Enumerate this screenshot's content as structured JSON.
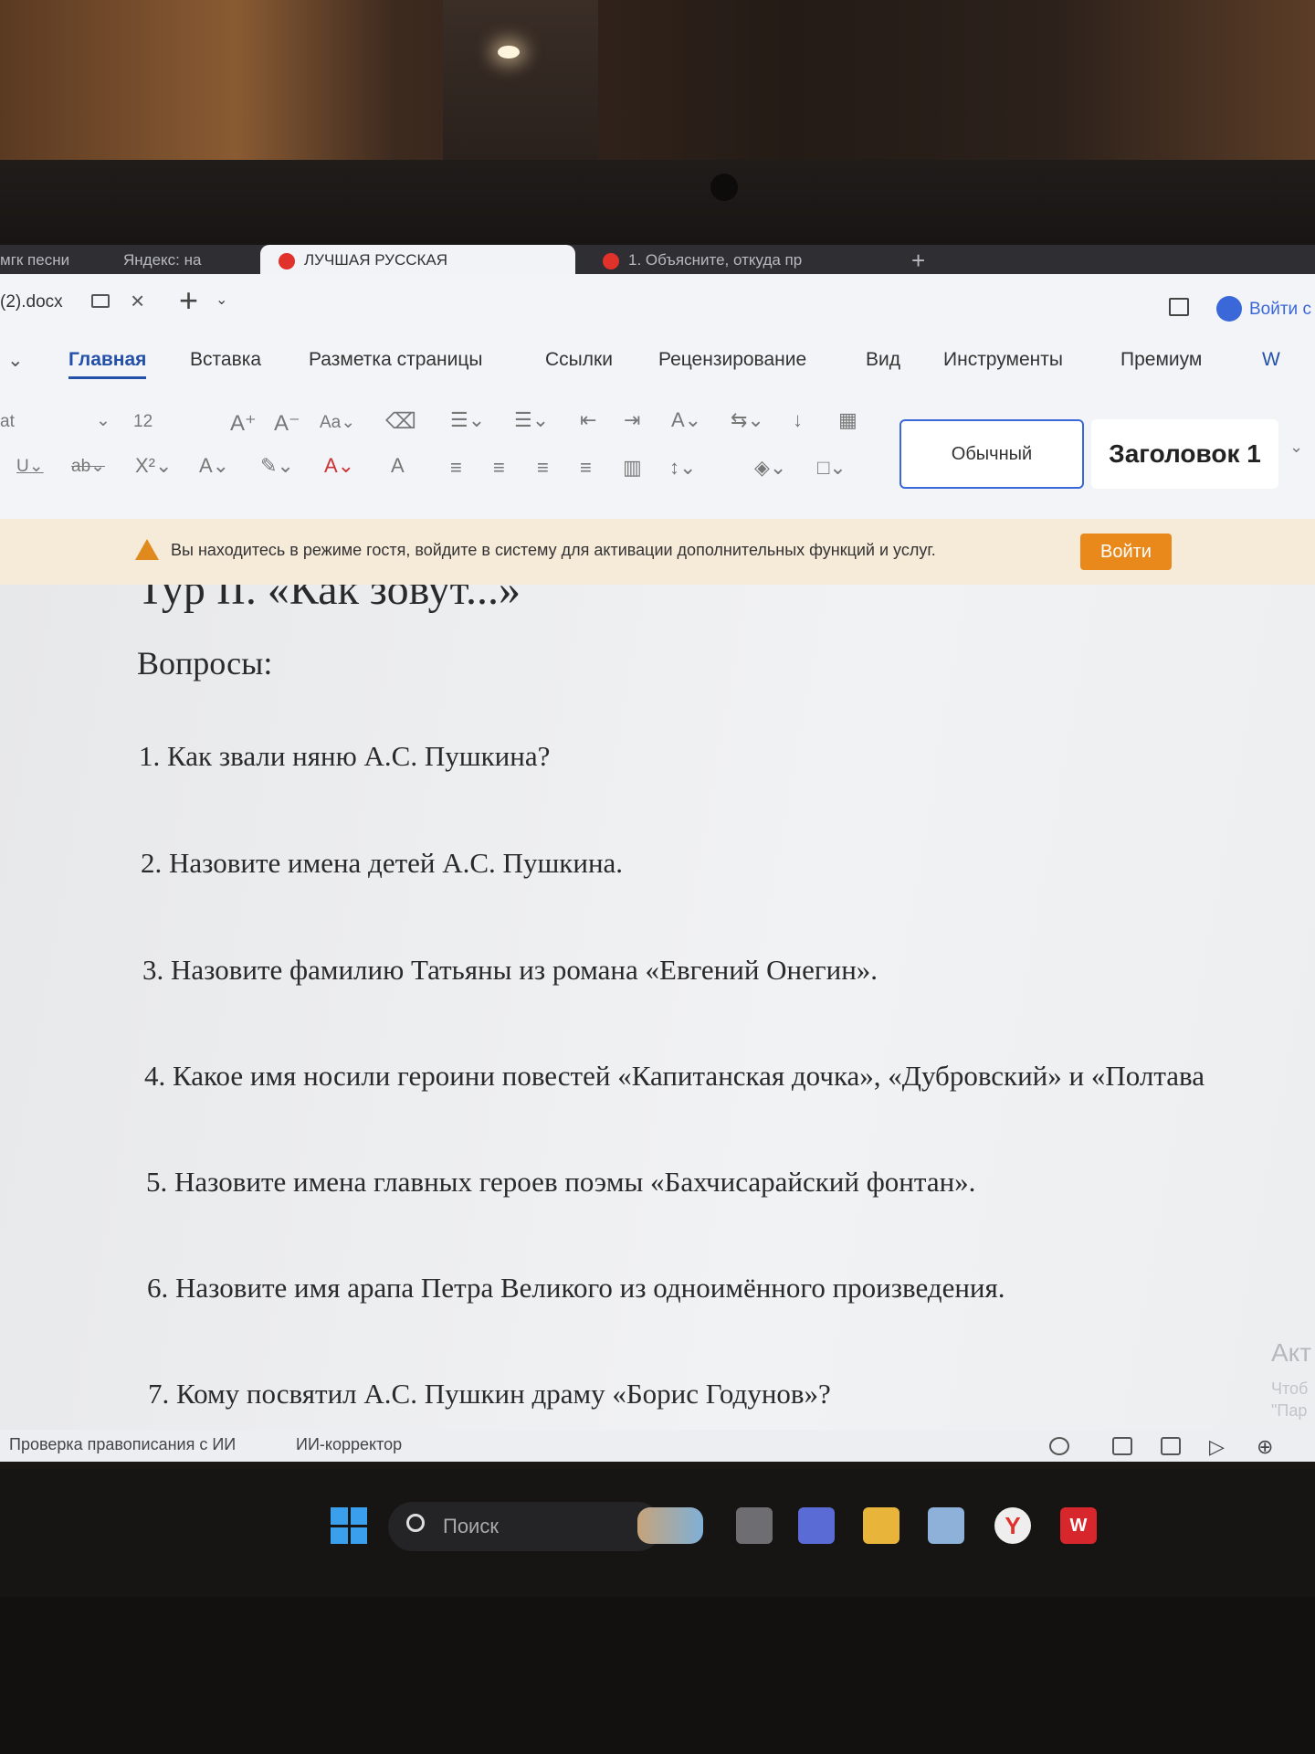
{
  "browser_tabs": [
    {
      "label": "мгк песни"
    },
    {
      "label": "Яндекс: на"
    },
    {
      "label": "ЛУЧШАЯ РУССКАЯ"
    },
    {
      "label": "1. Объясните, откуда пр"
    }
  ],
  "titlebar": {
    "doc_name": "(2).docx",
    "login": "Войти с"
  },
  "menu": {
    "items": [
      "Главная",
      "Вставка",
      "Разметка страницы",
      "Ссылки",
      "Рецензирование",
      "Вид",
      "Инструменты",
      "Премиум",
      "W"
    ]
  },
  "toolbar": {
    "font_name": "at",
    "font_size": "12",
    "style_normal": "Обычный",
    "style_heading1": "Заголовок 1"
  },
  "guest_bar": {
    "message": "Вы находитесь в режиме гостя, войдите в систему для активации дополнительных функций и услуг.",
    "button": "Войти"
  },
  "document": {
    "heading": "Тур II. «Как зовут...»",
    "subheading": "Вопросы:",
    "questions": [
      "1. Как звали няню А.С. Пушкина?",
      "2. Назовите имена детей А.С. Пушкина.",
      "3. Назовите фамилию Татьяны из романа «Евгений Онегин».",
      "4. Какое имя носили героини повестей «Капитанская дочка», «Дубровский» и «Полтава",
      "5. Назовите имена главных героев поэмы «Бахчисарайский фонтан».",
      "6. Назовите имя арапа Петра Великого из одноимённого произведения.",
      "7. Кому посвятил А.С. Пушкин драму «Борис Годунов»?"
    ],
    "watermark": "Акт",
    "watermark_sub": [
      "Чтоб",
      "\"Пар"
    ]
  },
  "statusbar": {
    "spellcheck": "Проверка правописания с ИИ",
    "ai_corrector": "ИИ-корректор"
  },
  "taskbar": {
    "search_placeholder": "Поиск"
  },
  "colors": {
    "accent": "#2350a8",
    "guest_button": "#e9891c",
    "style_border": "#3a68d8"
  }
}
